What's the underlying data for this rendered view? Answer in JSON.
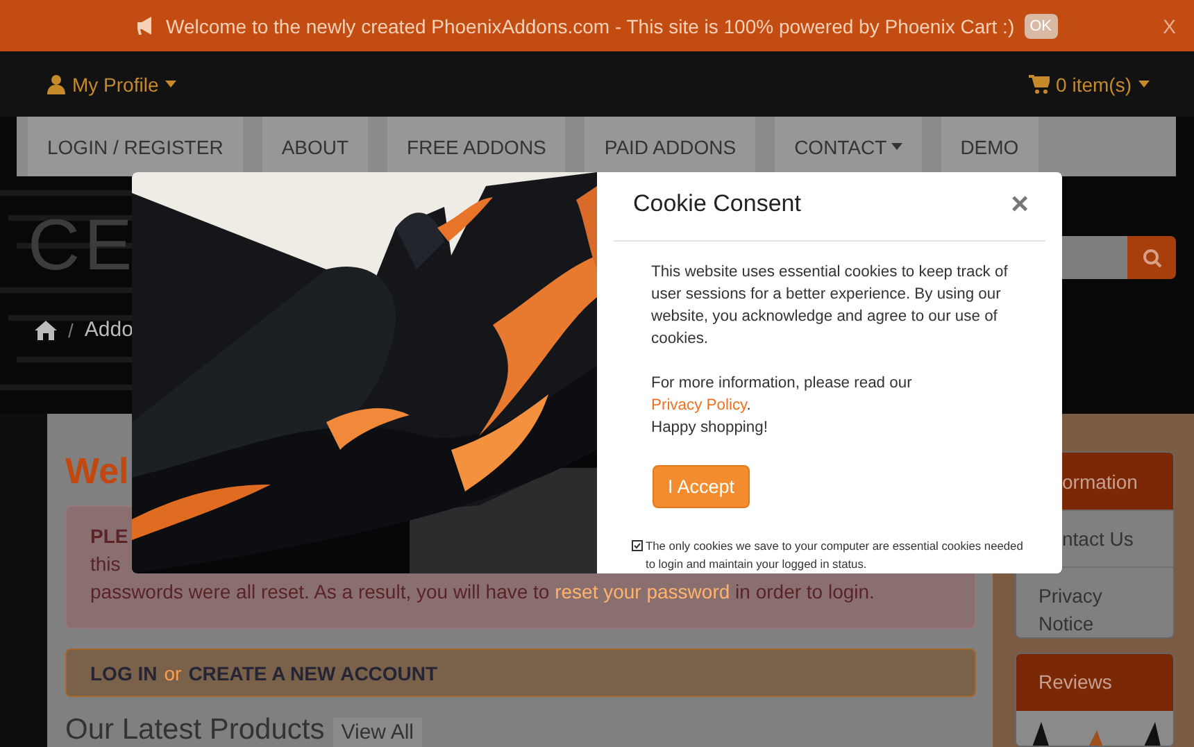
{
  "banner": {
    "text": "Welcome to the newly created PhoenixAddons.com - This site is 100% powered by Phoenix Cart :)",
    "ok_button": "OK",
    "close": "X"
  },
  "navbar": {
    "profile": "My Profile",
    "cart": "0 item(s)"
  },
  "menu": [
    {
      "label": "LOGIN / REGISTER",
      "dropdown": false
    },
    {
      "label": "ABOUT",
      "dropdown": false
    },
    {
      "label": "FREE ADDONS",
      "dropdown": false
    },
    {
      "label": "PAID ADDONS",
      "dropdown": false
    },
    {
      "label": "CONTACT",
      "dropdown": true
    },
    {
      "label": "DEMO",
      "dropdown": false
    }
  ],
  "header": {
    "logo_text": "CE",
    "breadcrumb": [
      {
        "separator": "/",
        "label": "Addo"
      }
    ]
  },
  "main": {
    "heading": "Wel",
    "alert": {
      "heading": "PLE",
      "line_2": "this",
      "line_3_before": "passwords were all reset. As a result, you will have to ",
      "line_3_link": "reset your password",
      "line_3_after": " in order to login."
    },
    "login_box": {
      "login": "LOG IN",
      "or": "or",
      "create": "CREATE A NEW ACCOUNT"
    },
    "latest": {
      "title": "Our Latest Products",
      "view_all": "View All"
    }
  },
  "sidebar": [
    {
      "title": "ormation",
      "items": [
        {
          "label": "ntact Us"
        },
        {
          "label": "Privacy Notice"
        }
      ]
    },
    {
      "title": "Reviews",
      "picture": true
    }
  ],
  "modal": {
    "title": "Cookie Consent",
    "close": "×",
    "paragraph_1": "This website uses essential cookies to keep track of user sessions for a better experience. By using our website, you acknowledge and agree to our use of cookies.",
    "paragraph_2_before": "For more information, please read our ",
    "privacy_link": "Privacy Policy",
    "paragraph_2_after": ".",
    "paragraph_3": "Happy shopping!",
    "accept_button": "I Accept",
    "note": "The only cookies we save to your computer are essential cookies needed to login and maintain your logged in status."
  }
}
